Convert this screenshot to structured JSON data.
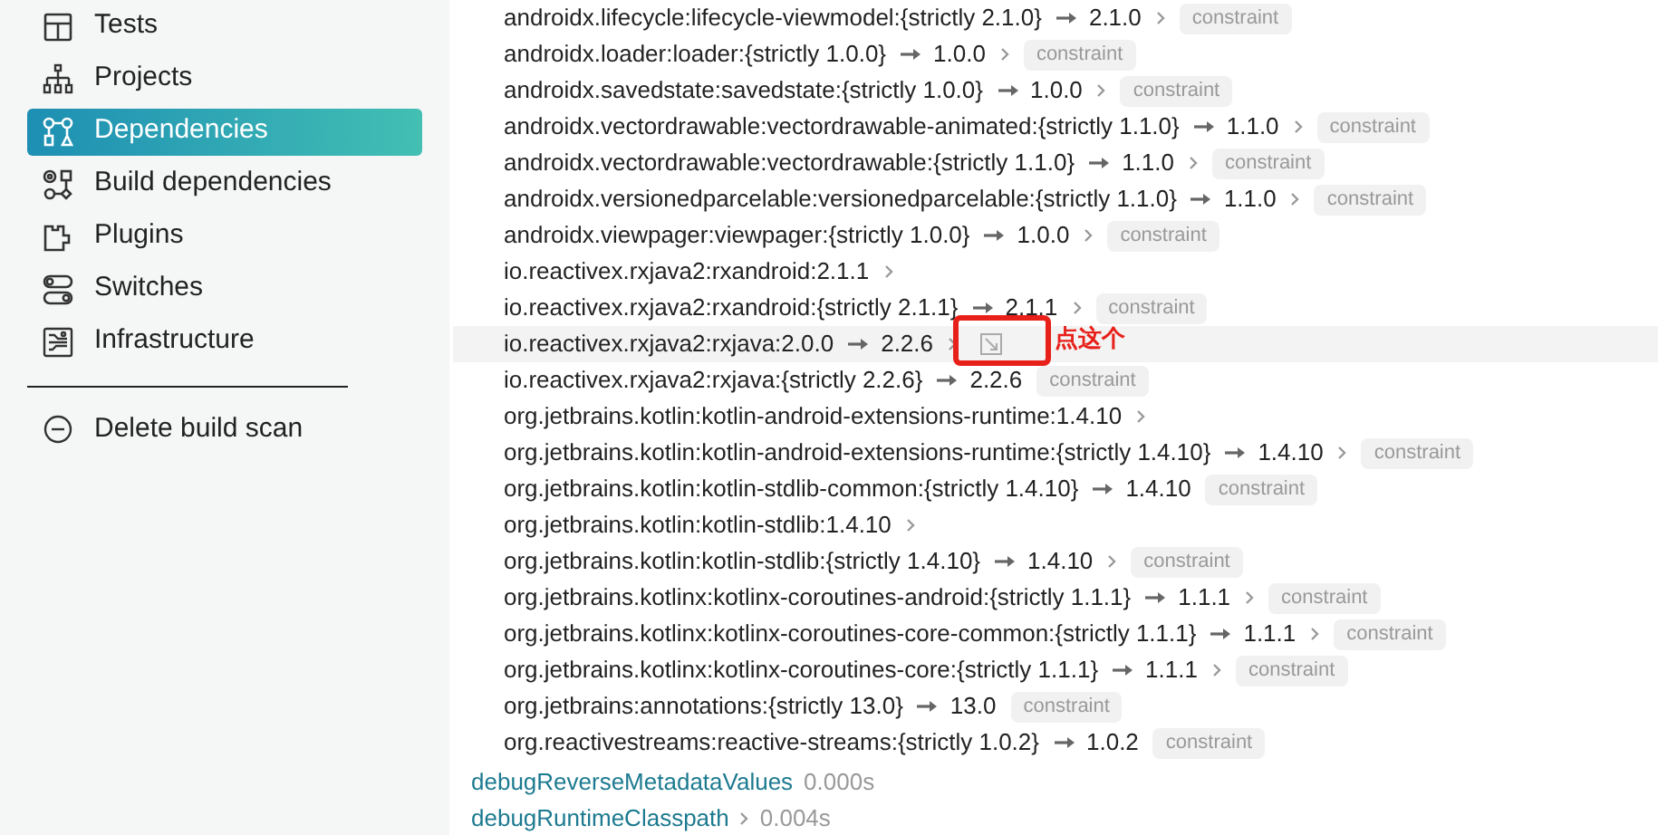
{
  "sidebar": {
    "items": [
      {
        "label": "Tests",
        "selected": false
      },
      {
        "label": "Projects",
        "selected": false
      },
      {
        "label": "Dependencies",
        "selected": true
      },
      {
        "label": "Build dependencies",
        "selected": false
      },
      {
        "label": "Plugins",
        "selected": false
      },
      {
        "label": "Switches",
        "selected": false
      },
      {
        "label": "Infrastructure",
        "selected": false
      }
    ],
    "delete_action": "Delete build scan"
  },
  "dependencies": [
    {
      "name": "androidx.lifecycle:lifecycle-viewmodel:{strictly 2.1.0}",
      "resolved": "2.1.0",
      "expandable": true,
      "badge": "constraint",
      "highlighted": false
    },
    {
      "name": "androidx.loader:loader:{strictly 1.0.0}",
      "resolved": "1.0.0",
      "expandable": true,
      "badge": "constraint",
      "highlighted": false
    },
    {
      "name": "androidx.savedstate:savedstate:{strictly 1.0.0}",
      "resolved": "1.0.0",
      "expandable": true,
      "badge": "constraint",
      "highlighted": false
    },
    {
      "name": "androidx.vectordrawable:vectordrawable-animated:{strictly 1.1.0}",
      "resolved": "1.1.0",
      "expandable": true,
      "badge": "constraint",
      "highlighted": false
    },
    {
      "name": "androidx.vectordrawable:vectordrawable:{strictly 1.1.0}",
      "resolved": "1.1.0",
      "expandable": true,
      "badge": "constraint",
      "highlighted": false
    },
    {
      "name": "androidx.versionedparcelable:versionedparcelable:{strictly 1.1.0}",
      "resolved": "1.1.0",
      "expandable": true,
      "badge": "constraint",
      "highlighted": false
    },
    {
      "name": "androidx.viewpager:viewpager:{strictly 1.0.0}",
      "resolved": "1.0.0",
      "expandable": true,
      "badge": "constraint",
      "highlighted": false
    },
    {
      "name": "io.reactivex.rxjava2:rxandroid:2.1.1",
      "expandable": true,
      "highlighted": false
    },
    {
      "name": "io.reactivex.rxjava2:rxandroid:{strictly 2.1.1}",
      "resolved": "2.1.1",
      "expandable": true,
      "badge": "constraint",
      "highlighted": false
    },
    {
      "name": "io.reactivex.rxjava2:rxjava:2.0.0",
      "resolved": "2.2.6",
      "expandable": true,
      "highlighted": true,
      "annotation": "点这个"
    },
    {
      "name": "io.reactivex.rxjava2:rxjava:{strictly 2.2.6}",
      "resolved": "2.2.6",
      "expandable": false,
      "badge": "constraint",
      "highlighted": false
    },
    {
      "name": "org.jetbrains.kotlin:kotlin-android-extensions-runtime:1.4.10",
      "expandable": true,
      "highlighted": false
    },
    {
      "name": "org.jetbrains.kotlin:kotlin-android-extensions-runtime:{strictly 1.4.10}",
      "resolved": "1.4.10",
      "expandable": true,
      "badge": "constraint",
      "highlighted": false
    },
    {
      "name": "org.jetbrains.kotlin:kotlin-stdlib-common:{strictly 1.4.10}",
      "resolved": "1.4.10",
      "expandable": false,
      "badge": "constraint",
      "highlighted": false
    },
    {
      "name": "org.jetbrains.kotlin:kotlin-stdlib:1.4.10",
      "expandable": true,
      "highlighted": false
    },
    {
      "name": "org.jetbrains.kotlin:kotlin-stdlib:{strictly 1.4.10}",
      "resolved": "1.4.10",
      "expandable": true,
      "badge": "constraint",
      "highlighted": false
    },
    {
      "name": "org.jetbrains.kotlinx:kotlinx-coroutines-android:{strictly 1.1.1}",
      "resolved": "1.1.1",
      "expandable": true,
      "badge": "constraint",
      "highlighted": false
    },
    {
      "name": "org.jetbrains.kotlinx:kotlinx-coroutines-core-common:{strictly 1.1.1}",
      "resolved": "1.1.1",
      "expandable": true,
      "badge": "constraint",
      "highlighted": false
    },
    {
      "name": "org.jetbrains.kotlinx:kotlinx-coroutines-core:{strictly 1.1.1}",
      "resolved": "1.1.1",
      "expandable": true,
      "badge": "constraint",
      "highlighted": false
    },
    {
      "name": "org.jetbrains:annotations:{strictly 13.0}",
      "resolved": "13.0",
      "expandable": false,
      "badge": "constraint",
      "highlighted": false
    },
    {
      "name": "org.reactivestreams:reactive-streams:{strictly 1.0.2}",
      "resolved": "1.0.2",
      "expandable": false,
      "badge": "constraint",
      "highlighted": false
    }
  ],
  "configurations": [
    {
      "name": "debugReverseMetadataValues",
      "expandable": false,
      "time": "0.000s"
    },
    {
      "name": "debugRuntimeClasspath",
      "expandable": true,
      "time": "0.004s"
    }
  ]
}
